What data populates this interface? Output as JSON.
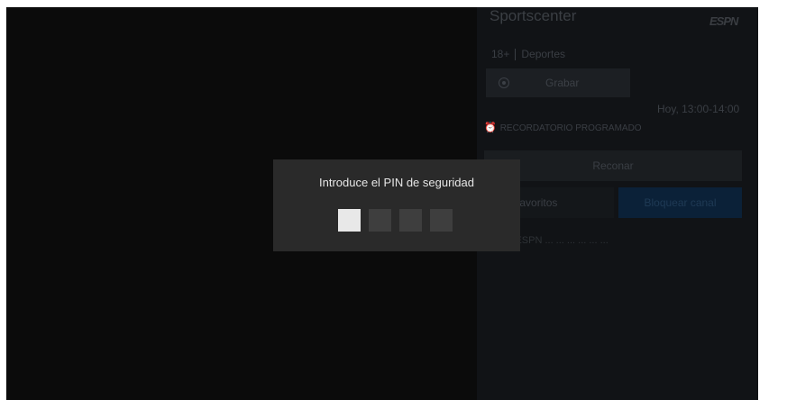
{
  "program": {
    "title": "Sportscenter",
    "channel_logo": "ESPN",
    "age_rating": "18+",
    "genre": "Deportes",
    "time_range": "Hoy, 13:00-14:00",
    "reminder_label": "RECORDATORIO PROGRAMADO",
    "description": "... ... ESPN ... ... ... ... ... ..."
  },
  "actions": {
    "record_label": "Grabar",
    "reconnect_label": "Reconar",
    "favorites_label": "nales favoritos",
    "block_channel_label": "Bloquear canal"
  },
  "pin_dialog": {
    "title": "Introduce el PIN de seguridad",
    "digit_count": 4,
    "active_index": 0
  },
  "icons": {
    "record": "record-icon",
    "alarm": "alarm-clock-icon"
  },
  "colors": {
    "background": "#0b0b0b",
    "dialog": "#2a2a2a",
    "active_box": "#e8e8e8",
    "inactive_box": "#3e3e3e",
    "accent_blue": "#0b2138"
  }
}
